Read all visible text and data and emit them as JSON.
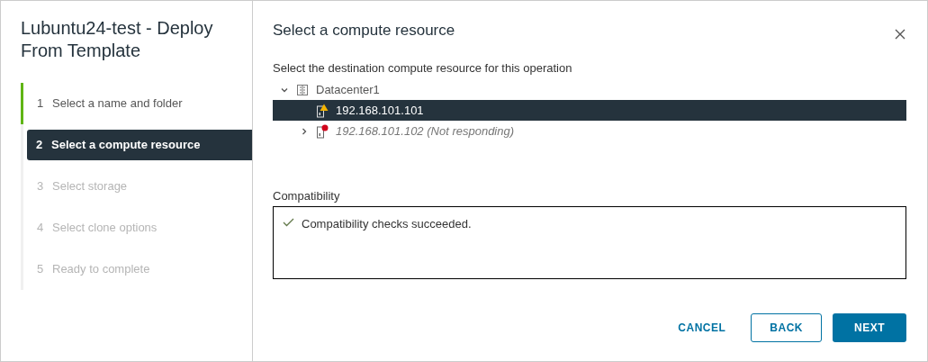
{
  "title": "Lubuntu24-test - Deploy From Template",
  "steps": [
    {
      "number": "1",
      "label": "Select a name and folder",
      "completed": true,
      "disabled": false,
      "selected": false
    },
    {
      "number": "2",
      "label": "Select a compute resource",
      "completed": false,
      "disabled": false,
      "selected": true
    },
    {
      "number": "3",
      "label": "Select storage",
      "completed": false,
      "disabled": true,
      "selected": false
    },
    {
      "number": "4",
      "label": "Select clone options",
      "completed": false,
      "disabled": true,
      "selected": false
    },
    {
      "number": "5",
      "label": "Ready to complete",
      "completed": false,
      "disabled": true,
      "selected": false
    }
  ],
  "page_title": "Select a compute resource",
  "instruction": "Select the destination compute resource for this operation",
  "tree": [
    {
      "label": "Datacenter1",
      "kind": "datacenter",
      "expanded": true,
      "selected": false,
      "children": [
        {
          "label": "192.168.101.101",
          "kind": "host-warning",
          "selected": true
        },
        {
          "label": "192.168.101.102 (Not responding)",
          "kind": "host-error",
          "expanded": false,
          "selected": false
        }
      ]
    }
  ],
  "compatibility": {
    "label": "Compatibility",
    "message": "Compatibility checks succeeded."
  },
  "buttons": [
    {
      "label": "CANCEL",
      "kind": "link"
    },
    {
      "label": "BACK",
      "kind": "outline"
    },
    {
      "label": "NEXT",
      "kind": "primary"
    }
  ]
}
